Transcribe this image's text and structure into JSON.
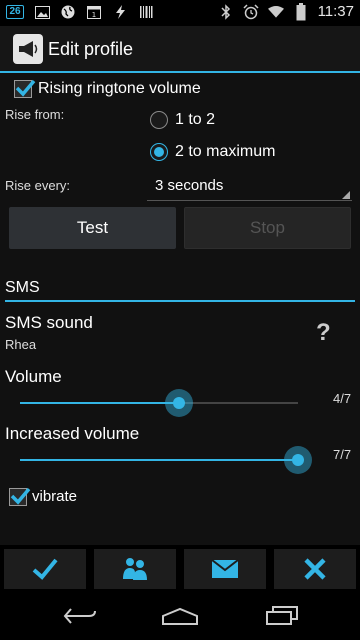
{
  "status_bar": {
    "badge": "26",
    "time": "11:37",
    "icons": [
      "image-icon",
      "globe-icon",
      "calendar-icon",
      "lightning-icon",
      "barcode-icon",
      "bluetooth-icon",
      "alarm-icon",
      "wifi-icon",
      "battery-icon"
    ]
  },
  "action_bar": {
    "title": "Edit profile",
    "logo_icon": "megaphone-icon"
  },
  "rising": {
    "checkbox_label": "Rising ringtone volume",
    "checked": true,
    "rise_from_label": "Rise from:",
    "options": [
      "1 to 2",
      "2 to maximum"
    ],
    "selected_index": 1,
    "rise_every_label": "Rise every:",
    "rise_every_value": "3 seconds"
  },
  "buttons": {
    "test": "Test",
    "stop": "Stop"
  },
  "sms": {
    "section_title": "SMS",
    "sound_label": "SMS sound",
    "sound_value": "Rhea",
    "help_icon_text": "?",
    "volume_label": "Volume",
    "volume_value": "4/7",
    "volume_level": 0.5714,
    "increased_label": "Increased volume",
    "increased_value": "7/7",
    "increased_level": 1.0,
    "vibrate_label": "vibrate",
    "vibrate_checked": true
  },
  "bottom_bar": {
    "icons": [
      "checkmark-icon",
      "contacts-icon",
      "envelope-icon",
      "close-icon"
    ]
  },
  "nav_bar": {
    "icons": [
      "back-icon",
      "home-icon",
      "recents-icon"
    ]
  },
  "colors": {
    "accent": "#33b5e5",
    "bottom_icon": "#33b5e5"
  }
}
